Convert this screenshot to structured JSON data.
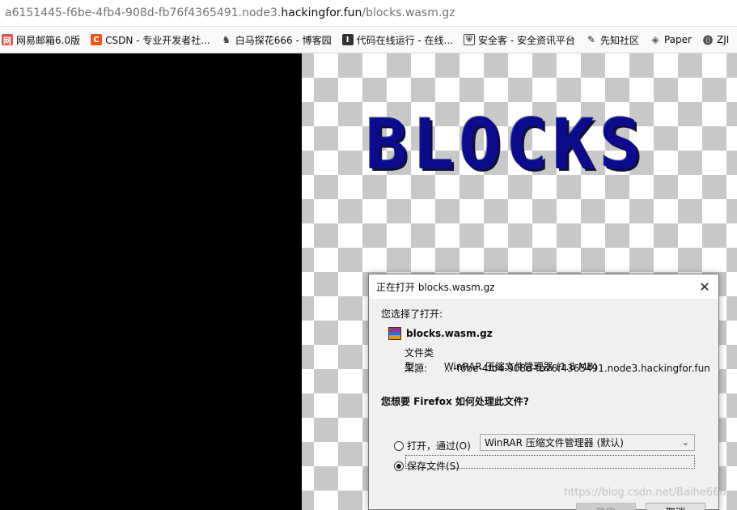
{
  "address_bar": {
    "url_prefix": "a6151445-f6be-4fb4-908d-fb76f4365491.node3.",
    "url_host": "hackingfor.fun",
    "url_path": "/blocks.wasm.gz"
  },
  "bookmarks": [
    {
      "label": "网易邮箱6.0版",
      "icon": "netease-mail-icon",
      "color": "#d9534f"
    },
    {
      "label": "CSDN - 专业开发者社...",
      "icon": "csdn-icon",
      "color": "#e25a1c"
    },
    {
      "label": "白马探花666 - 博客园",
      "icon": "cnblogs-icon",
      "color": "#444444"
    },
    {
      "label": "代码在线运行 - 在线...",
      "icon": "code-runner-icon",
      "color": "#333333"
    },
    {
      "label": "安全客 - 安全资讯平台",
      "icon": "anquanke-icon",
      "color": "#444444"
    },
    {
      "label": "先知社区",
      "icon": "xianzhi-icon",
      "color": "#222222"
    },
    {
      "label": "Paper",
      "icon": "paper-icon",
      "color": "#555555"
    },
    {
      "label": "ZJI",
      "icon": "zji-icon",
      "color": "#555555"
    }
  ],
  "page": {
    "logo_text": "BLOCKS"
  },
  "dialog": {
    "title": "正在打开 blocks.wasm.gz",
    "close_glyph": "✕",
    "prompt": "您选择了打开:",
    "filename": "blocks.wasm.gz",
    "type_label": "文件类型:",
    "type_value": "WinRAR 压缩文件管理器 (1.8 MB)",
    "source_label": "来源:",
    "source_value": "...-f6be-4fb4-908d-fb76f4365491.node3.hackingfor.fun",
    "question": "您想要 Firefox 如何处理此文件?",
    "option_open_label": "打开，通过(O)",
    "option_open_app": "WinRAR 压缩文件管理器 (默认)",
    "option_save_label": "保存文件(S)",
    "selected_option": "save",
    "ok_label": "确定",
    "cancel_label": "取消"
  },
  "watermark": "https://blog.csdn.net/Baihe666"
}
